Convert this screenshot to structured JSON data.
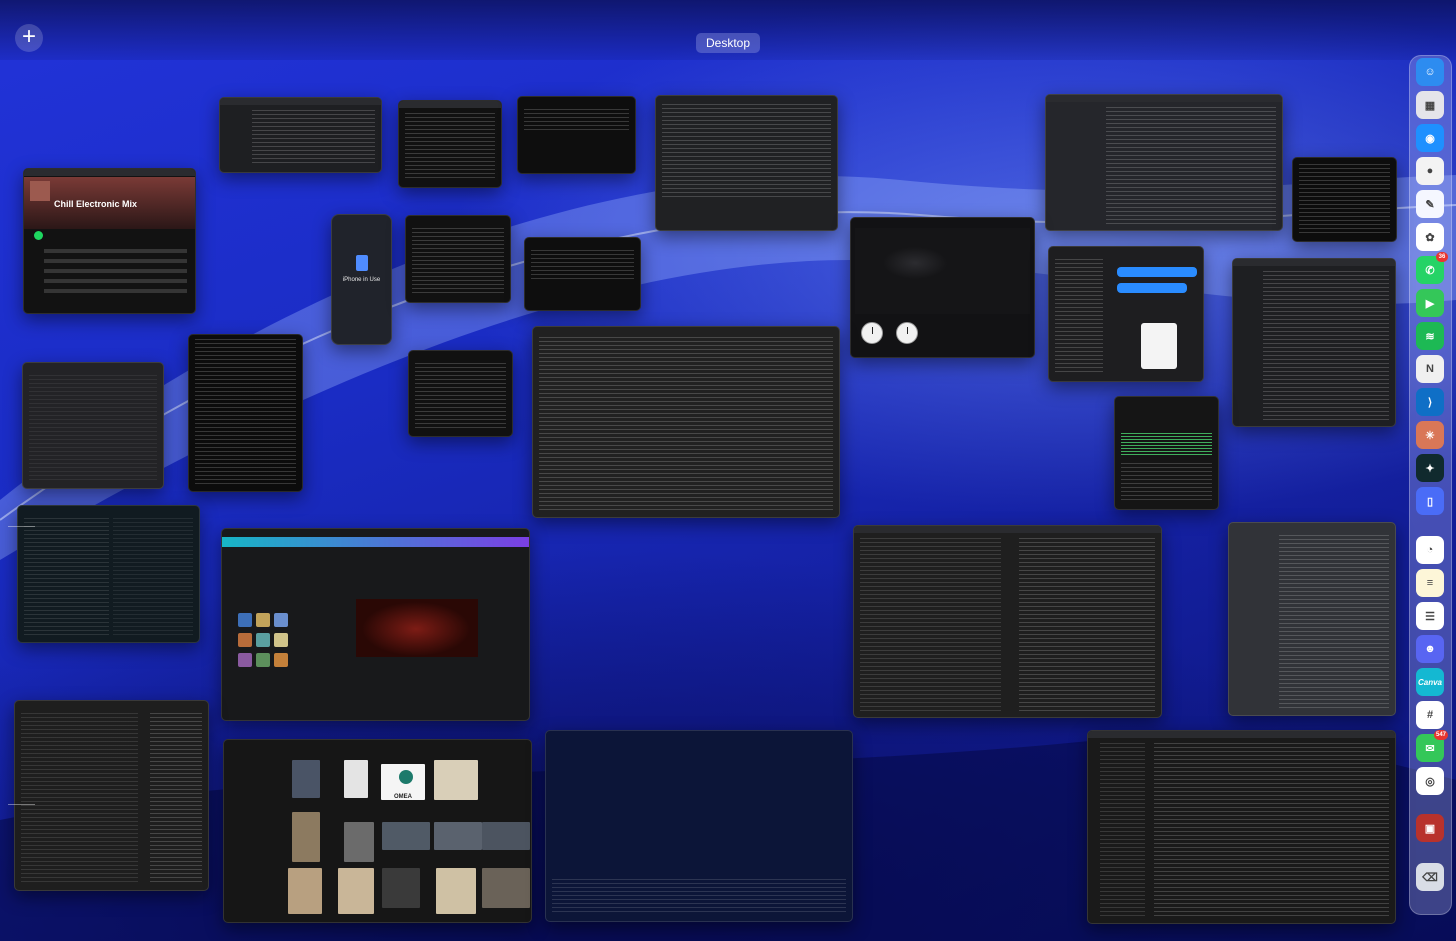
{
  "space_bar": {
    "add_symbol": "+",
    "current_space": "Desktop"
  },
  "windows": {
    "spotify": {
      "playlist_title": "Chill Electronic Mix"
    },
    "iphone_mirroring": {
      "status": "iPhone in Use"
    },
    "photos": {
      "tile_text": "OMEA"
    }
  },
  "dock": {
    "items": [
      {
        "name": "Finder",
        "icon": "finder-icon",
        "color": "#2d8cf0"
      },
      {
        "name": "Launchpad",
        "icon": "launchpad-icon",
        "color": "#e4e4ea"
      },
      {
        "name": "Safari",
        "icon": "safari-icon",
        "color": "#1e90ff"
      },
      {
        "name": "Chrome",
        "icon": "chrome-icon",
        "color": "#f3f3f3"
      },
      {
        "name": "Freeform",
        "icon": "freeform-icon",
        "color": "#f5f7ff"
      },
      {
        "name": "Photos",
        "icon": "photos-icon",
        "color": "#ffffff"
      },
      {
        "name": "WhatsApp",
        "icon": "whatsapp-icon",
        "color": "#25d366",
        "badge": "36"
      },
      {
        "name": "FaceTime",
        "icon": "facetime-icon",
        "color": "#34c759"
      },
      {
        "name": "Spotify",
        "icon": "spotify-icon",
        "color": "#1db954"
      },
      {
        "name": "Notion",
        "icon": "notion-icon",
        "color": "#f0f0f0"
      },
      {
        "name": "VS Code",
        "icon": "vscode-icon",
        "color": "#0f6fc6"
      },
      {
        "name": "Claude",
        "icon": "claude-icon",
        "color": "#d97757"
      },
      {
        "name": "Perplexity",
        "icon": "perplexity-icon",
        "color": "#102a2e"
      },
      {
        "name": "Simulator",
        "icon": "simulator-icon",
        "color": "#4a6cf7"
      },
      {
        "name": "Clock",
        "icon": "clock-icon",
        "color": "#ffffff"
      },
      {
        "name": "Notes",
        "icon": "notes-icon",
        "color": "#fdf6d8"
      },
      {
        "name": "Reminders",
        "icon": "reminders-icon",
        "color": "#ffffff"
      },
      {
        "name": "Discord",
        "icon": "discord-icon",
        "color": "#5865f2"
      },
      {
        "name": "Canva",
        "icon": "canva-icon",
        "color": "#14b8d2",
        "label": "Canva"
      },
      {
        "name": "Slack",
        "icon": "slack-icon",
        "color": "#ffffff"
      },
      {
        "name": "Messages",
        "icon": "messages-icon",
        "color": "#34c759",
        "badge": "547"
      },
      {
        "name": "ChatGPT",
        "icon": "chatgpt-icon",
        "color": "#ffffff"
      },
      {
        "name": "Backpack",
        "icon": "backpack-icon",
        "color": "#b8322c"
      },
      {
        "name": "Trash",
        "icon": "trash-icon",
        "color": "#d9dde6"
      }
    ]
  }
}
